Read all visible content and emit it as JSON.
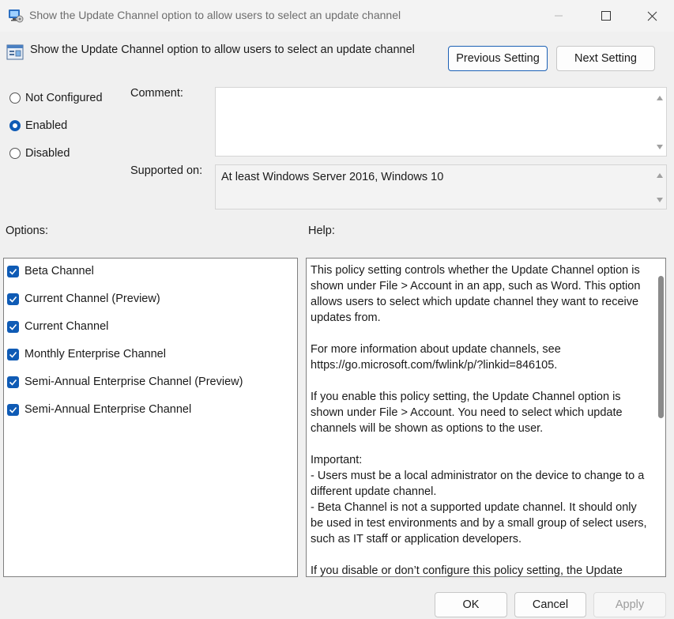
{
  "window": {
    "title": "Show the Update Channel option to allow users to select an update channel"
  },
  "header": {
    "policy_name": "Show the Update Channel option to allow users to select an update channel",
    "prev_label": "Previous Setting",
    "next_label": "Next Setting"
  },
  "state": {
    "options": [
      "Not Configured",
      "Enabled",
      "Disabled"
    ],
    "selected": "Enabled"
  },
  "comment": {
    "label": "Comment:",
    "value": ""
  },
  "supported": {
    "label": "Supported on:",
    "value": "At least Windows Server 2016, Windows 10"
  },
  "options_panel": {
    "label": "Options:",
    "items": [
      {
        "label": "Beta Channel",
        "checked": true
      },
      {
        "label": "Current Channel (Preview)",
        "checked": true
      },
      {
        "label": "Current Channel",
        "checked": true
      },
      {
        "label": "Monthly Enterprise Channel",
        "checked": true
      },
      {
        "label": "Semi-Annual Enterprise Channel (Preview)",
        "checked": true
      },
      {
        "label": "Semi-Annual Enterprise Channel",
        "checked": true
      }
    ]
  },
  "help_panel": {
    "label": "Help:",
    "paragraphs": [
      "This policy setting controls whether the Update Channel option is shown under File > Account in an app, such as Word. This option allows users to select which update channel they want to receive updates from.",
      "For more information about update channels, see https://go.microsoft.com/fwlink/p/?linkid=846105.",
      "If you enable this policy setting, the Update Channel option is shown under File > Account. You need to select which update channels will be shown as options to the user.",
      "Important:\n- Users must be a local administrator on the device to change to a different update channel.\n- Beta Channel is not a supported update channel. It should only be used in test environments and by a small group of select users, such as IT staff or application developers.",
      "If you disable or don’t configure this policy setting, the Update"
    ]
  },
  "footer": {
    "ok_label": "OK",
    "cancel_label": "Cancel",
    "apply_label": "Apply"
  },
  "colors": {
    "accent": "#0f5bb5",
    "background": "#f0f0f0"
  }
}
